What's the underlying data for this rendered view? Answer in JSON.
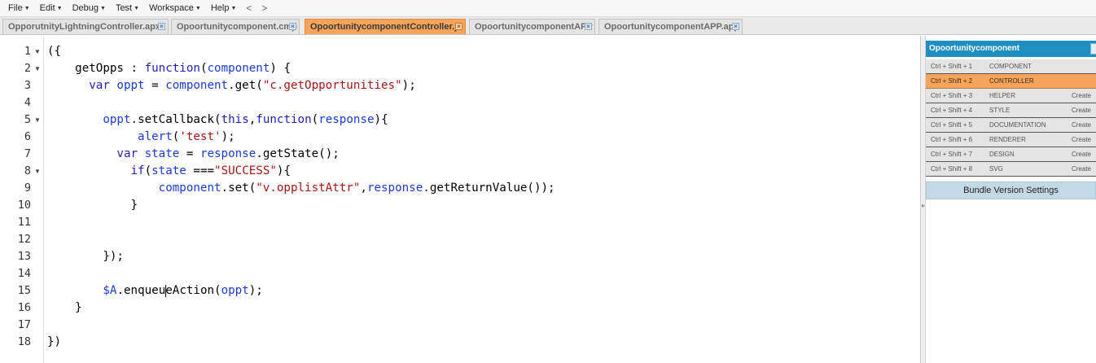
{
  "menu": {
    "file": "File",
    "edit": "Edit",
    "debug": "Debug",
    "test": "Test",
    "workspace": "Workspace",
    "help": "Help",
    "back": "<",
    "forward": ">"
  },
  "tabs": [
    {
      "label": "OpporutnityLightningController.apxc",
      "active": false
    },
    {
      "label": "Opoortunitycomponent.cmp",
      "active": false
    },
    {
      "label": "OpoortunitycomponentController.js",
      "active": true
    },
    {
      "label": "OpoortunitycomponentAPP",
      "active": false
    },
    {
      "label": "OpoortunitycomponentAPP.app",
      "active": false
    }
  ],
  "editor": {
    "line_numbers": [
      "1",
      "2",
      "3",
      "4",
      "5",
      "6",
      "7",
      "8",
      "9",
      "10",
      "11",
      "12",
      "13",
      "14",
      "15",
      "16",
      "17",
      "18"
    ],
    "folded_lines": [
      1,
      2,
      5,
      8
    ],
    "cursor_line": 15,
    "lines": [
      "({",
      "    getOpps : function(component) {",
      "      var oppt = component.get(\"c.getOpportunities\");",
      "",
      "        oppt.setCallback(this,function(response){",
      "             alert('test');",
      "          var state = response.getState();",
      "            if(state ===\"SUCCESS\"){",
      "                component.set(\"v.opplistAttr\",response.getReturnValue());",
      "            }",
      "",
      "",
      "        });",
      "",
      "        $A.enqueueAction(oppt);",
      "    }",
      "",
      "})"
    ]
  },
  "panel": {
    "title": "Opoortunitycomponent",
    "rows": [
      {
        "shortcut": "Ctrl + Shift + 1",
        "name": "COMPONENT",
        "action": ""
      },
      {
        "shortcut": "Ctrl + Shift + 2",
        "name": "CONTROLLER",
        "action": "",
        "active": true
      },
      {
        "shortcut": "Ctrl + Shift + 3",
        "name": "HELPER",
        "action": "Create"
      },
      {
        "shortcut": "Ctrl + Shift + 4",
        "name": "STYLE",
        "action": "Create"
      },
      {
        "shortcut": "Ctrl + Shift + 5",
        "name": "DOCUMENTATION",
        "action": "Create"
      },
      {
        "shortcut": "Ctrl + Shift + 6",
        "name": "RENDERER",
        "action": "Create"
      },
      {
        "shortcut": "Ctrl + Shift + 7",
        "name": "DESIGN",
        "action": "Create"
      },
      {
        "shortcut": "Ctrl + Shift + 8",
        "name": "SVG",
        "action": "Create"
      }
    ],
    "version_button": "Bundle Version Settings"
  },
  "colors": {
    "active_tab": "#f6a45b",
    "panel_header": "#1f8fc2",
    "keyword": "#1f1fb0",
    "string": "#a31515",
    "identifier": "#1a3bd1"
  }
}
